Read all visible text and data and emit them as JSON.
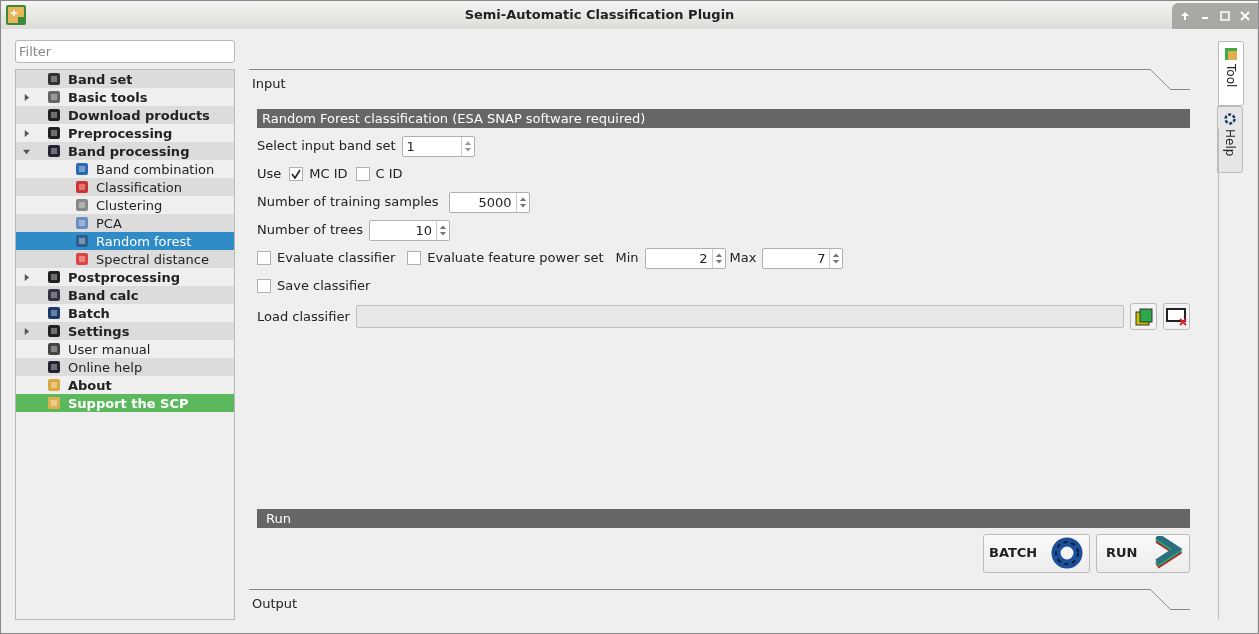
{
  "window": {
    "title": "Semi-Automatic Classification Plugin"
  },
  "filter": {
    "placeholder": "Filter"
  },
  "tree": [
    {
      "label": "Band set",
      "kind": "section"
    },
    {
      "label": "Basic tools",
      "kind": "section",
      "expanded": false
    },
    {
      "label": "Download products",
      "kind": "section"
    },
    {
      "label": "Preprocessing",
      "kind": "section",
      "expanded": false
    },
    {
      "label": "Band processing",
      "kind": "section",
      "expanded": true,
      "children": [
        {
          "label": "Band combination",
          "selected": false
        },
        {
          "label": "Classification",
          "selected": false
        },
        {
          "label": "Clustering",
          "selected": false
        },
        {
          "label": "PCA",
          "selected": false
        },
        {
          "label": "Random forest",
          "selected": true
        },
        {
          "label": "Spectral distance",
          "selected": false
        }
      ]
    },
    {
      "label": "Postprocessing",
      "kind": "section",
      "expanded": false
    },
    {
      "label": "Band calc",
      "kind": "section"
    },
    {
      "label": "Batch",
      "kind": "section"
    },
    {
      "label": "Settings",
      "kind": "section",
      "expanded": false
    },
    {
      "label": "User manual",
      "kind": "link"
    },
    {
      "label": "Online help",
      "kind": "link"
    },
    {
      "label": "About",
      "kind": "section"
    },
    {
      "label": "Support the SCP",
      "kind": "promo"
    }
  ],
  "input_section": {
    "title": "Input"
  },
  "tool_title": "Random Forest classification (ESA SNAP software required)",
  "band_set": {
    "label": "Select input band set",
    "value": "1"
  },
  "use": {
    "label": "Use",
    "options": [
      {
        "label": "MC ID",
        "checked": true
      },
      {
        "label": "C ID",
        "checked": false
      }
    ]
  },
  "training_samples": {
    "label": "Number of training samples",
    "value": "5000"
  },
  "trees": {
    "label": "Number of trees",
    "value": "10"
  },
  "evaluate_classifier": {
    "label": "Evaluate classifier",
    "checked": false
  },
  "evaluate_feature_power_set": {
    "label": "Evaluate feature power set",
    "checked": false
  },
  "min": {
    "label": "Min",
    "value": "2"
  },
  "max": {
    "label": "Max",
    "value": "7"
  },
  "save_classifier": {
    "label": "Save classifier",
    "checked": false
  },
  "load_classifier": {
    "label": "Load classifier"
  },
  "run_section": {
    "title": "Run"
  },
  "buttons": [
    {
      "label": "BATCH",
      "kind": "batch"
    },
    {
      "label": "RUN",
      "kind": "run"
    }
  ],
  "output_section": {
    "title": "Output"
  },
  "side_tabs": [
    {
      "label": "Tool",
      "selected": true,
      "kind": "tool"
    },
    {
      "label": "Help",
      "selected": false,
      "kind": "help"
    }
  ]
}
